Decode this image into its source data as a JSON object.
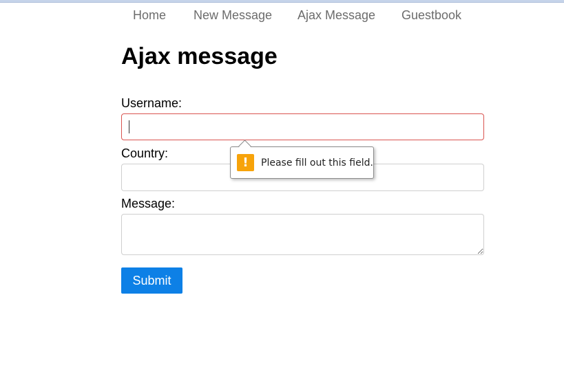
{
  "nav": {
    "items": [
      {
        "label": "Home"
      },
      {
        "label": "New Message"
      },
      {
        "label": "Ajax Message"
      },
      {
        "label": "Guestbook"
      }
    ]
  },
  "page": {
    "title": "Ajax message"
  },
  "form": {
    "username": {
      "label": "Username:",
      "value": ""
    },
    "country": {
      "label": "Country:",
      "value": ""
    },
    "message": {
      "label": "Message:",
      "value": ""
    },
    "submit_label": "Submit"
  },
  "validation": {
    "message": "Please fill out this field.",
    "icon": "warning-icon",
    "icon_glyph": "!",
    "icon_color": "#f7a30a"
  },
  "colors": {
    "accent": "#0d80e6",
    "invalid_border": "#d9534f"
  }
}
